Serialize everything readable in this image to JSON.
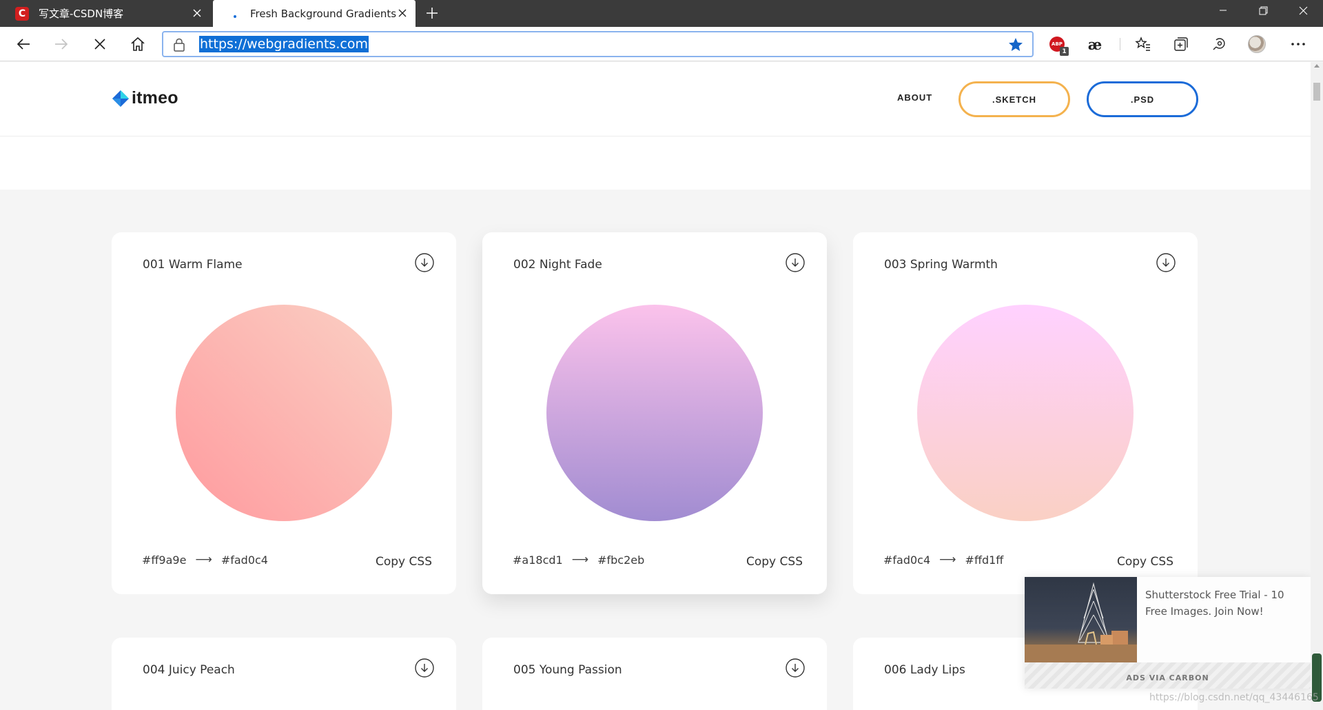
{
  "browser": {
    "tabs": [
      {
        "title": "写文章-CSDN博客",
        "favicon": "C",
        "active": false
      },
      {
        "title": "Fresh Background Gradients | We",
        "active": true
      }
    ],
    "url": "https://webgradients.com",
    "extension_badge": "1",
    "abp_label": "ABP",
    "ae_label": "æ"
  },
  "site": {
    "logo": "itmeo",
    "nav": {
      "about": "ABOUT",
      "sketch": ".SKETCH",
      "psd": ".PSD"
    },
    "colors": {
      "sketch_border": "#f4b24e",
      "psd_border": "#1b6bd8",
      "logo_blue": "#1b6bd8",
      "logo_cyan": "#2ed3e8"
    }
  },
  "gradients": [
    {
      "name": "001 Warm Flame",
      "from": "#ff9a9e",
      "to": "#fad0c4",
      "arrow": "⟶",
      "copy": "Copy CSS",
      "css": "linear-gradient(45deg, #ff9a9e 0%, #fad0c4 99%, #fad0c4 100%)"
    },
    {
      "name": "002 Night Fade",
      "from": "#a18cd1",
      "to": "#fbc2eb",
      "arrow": "⟶",
      "copy": "Copy CSS",
      "css": "linear-gradient(to top, #a18cd1 0%, #fbc2eb 100%)"
    },
    {
      "name": "003 Spring Warmth",
      "from": "#fad0c4",
      "to": "#ffd1ff",
      "arrow": "⟶",
      "copy": "Copy CSS",
      "css": "linear-gradient(to top, #fad0c4 0%, #ffd1ff 100%)"
    },
    {
      "name": "004 Juicy Peach"
    },
    {
      "name": "005 Young Passion"
    },
    {
      "name": "006 Lady Lips"
    }
  ],
  "ad": {
    "text": "Shutterstock Free Trial - 10 Free Images. Join Now!",
    "via": "ADS VIA CARBON"
  },
  "watermark": "https://blog.csdn.net/qq_43446165"
}
